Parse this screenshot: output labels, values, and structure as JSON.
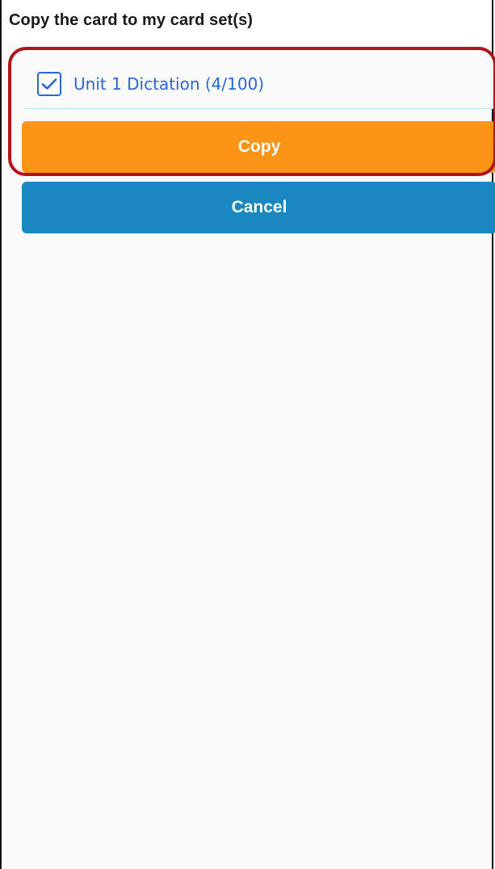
{
  "dialog": {
    "title": "Copy the card to my card set(s)"
  },
  "card_sets": [
    {
      "label": "Unit 1 Dictation (4/100)",
      "checked": true
    }
  ],
  "buttons": {
    "copy_label": "Copy",
    "cancel_label": "Cancel"
  },
  "colors": {
    "accent_blue": "#2b66d9",
    "copy_button": "#fb9417",
    "cancel_button": "#1a87c0",
    "highlight_outline": "#b0151a"
  },
  "icons": {
    "checkbox": "check-icon"
  }
}
